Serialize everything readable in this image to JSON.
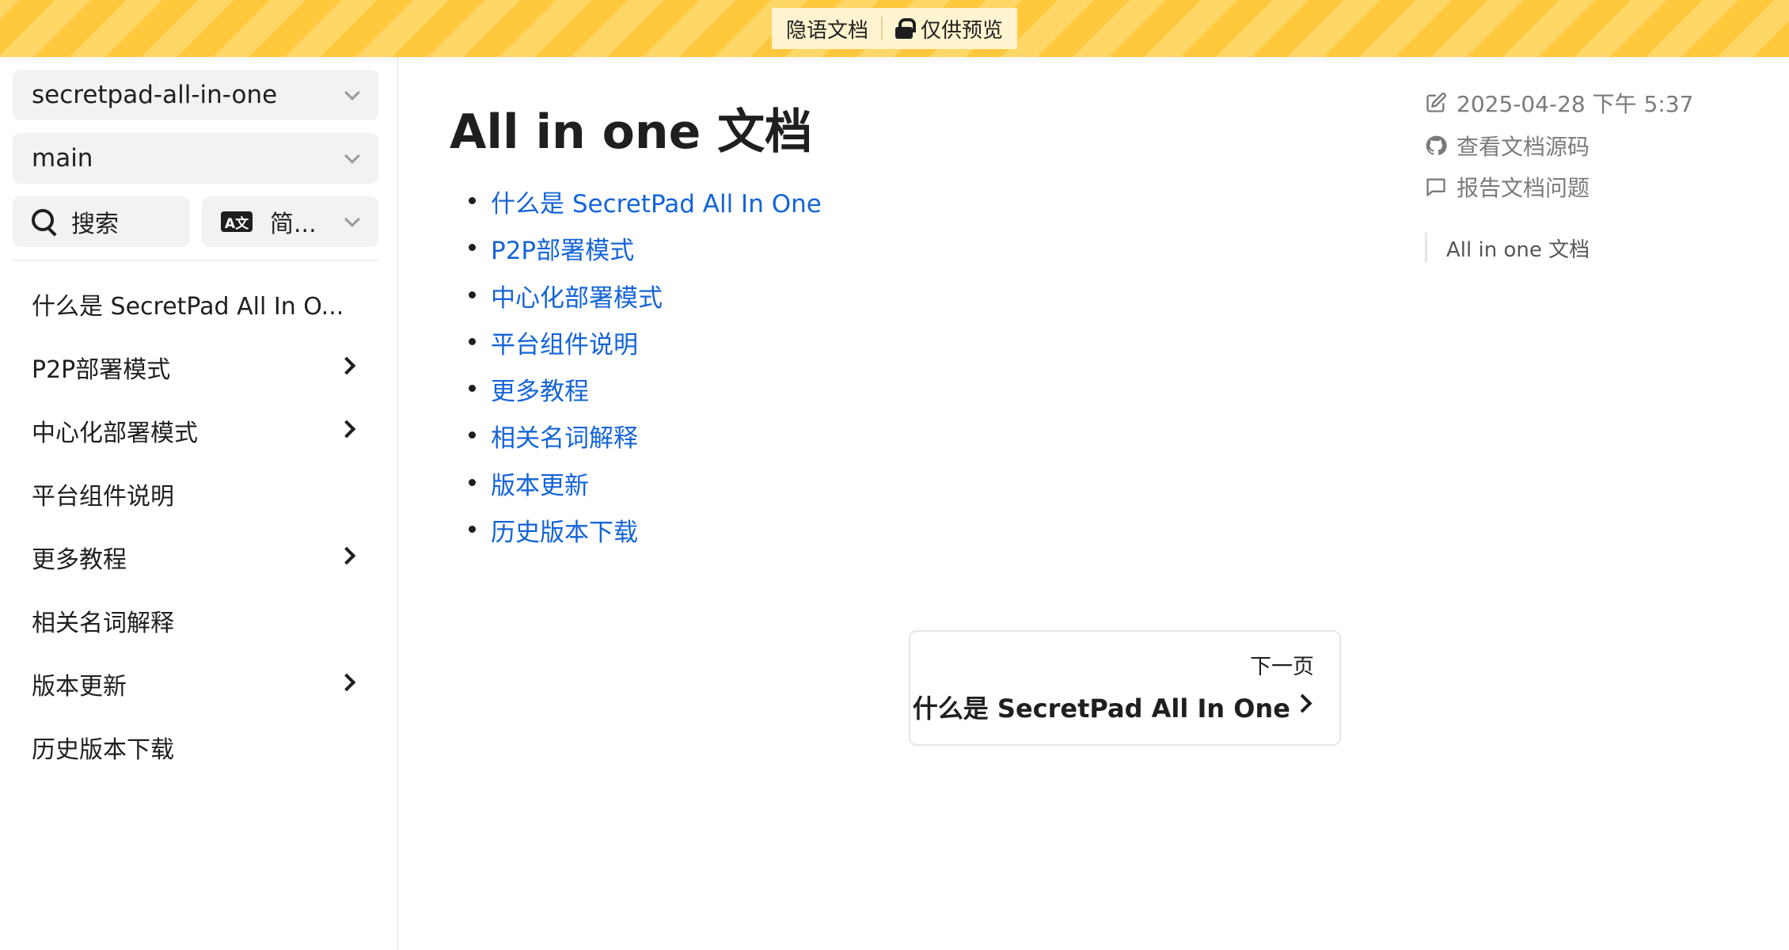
{
  "banner": {
    "doc_label": "隐语文档",
    "preview_label": "仅供预览"
  },
  "sidebar": {
    "project_select": "secretpad-all-in-one",
    "branch_select": "main",
    "search_label": "搜索",
    "language_label": "简...",
    "translate_icon_text": "A文",
    "items": [
      {
        "label": "什么是 SecretPad All In O...",
        "expandable": false
      },
      {
        "label": "P2P部署模式",
        "expandable": true
      },
      {
        "label": "中心化部署模式",
        "expandable": true
      },
      {
        "label": "平台组件说明",
        "expandable": false
      },
      {
        "label": "更多教程",
        "expandable": true
      },
      {
        "label": "相关名词解释",
        "expandable": false
      },
      {
        "label": "版本更新",
        "expandable": true
      },
      {
        "label": "历史版本下载",
        "expandable": false
      }
    ]
  },
  "main": {
    "title": "All in one 文档",
    "links": [
      "什么是 SecretPad All In One",
      "P2P部署模式",
      "中心化部署模式",
      "平台组件说明",
      "更多教程",
      "相关名词解释",
      "版本更新",
      "历史版本下载"
    ],
    "next": {
      "label": "下一页",
      "title": "什么是 SecretPad All In One"
    }
  },
  "meta": {
    "updated": "2025-04-28 下午 5:37",
    "source_link": "查看文档源码",
    "report_link": "报告文档问题",
    "toc_entry": "All in one 文档"
  },
  "colors": {
    "banner_stripe_a": "#ffc83d",
    "banner_stripe_b": "#ffd767",
    "link": "#1464d8"
  }
}
